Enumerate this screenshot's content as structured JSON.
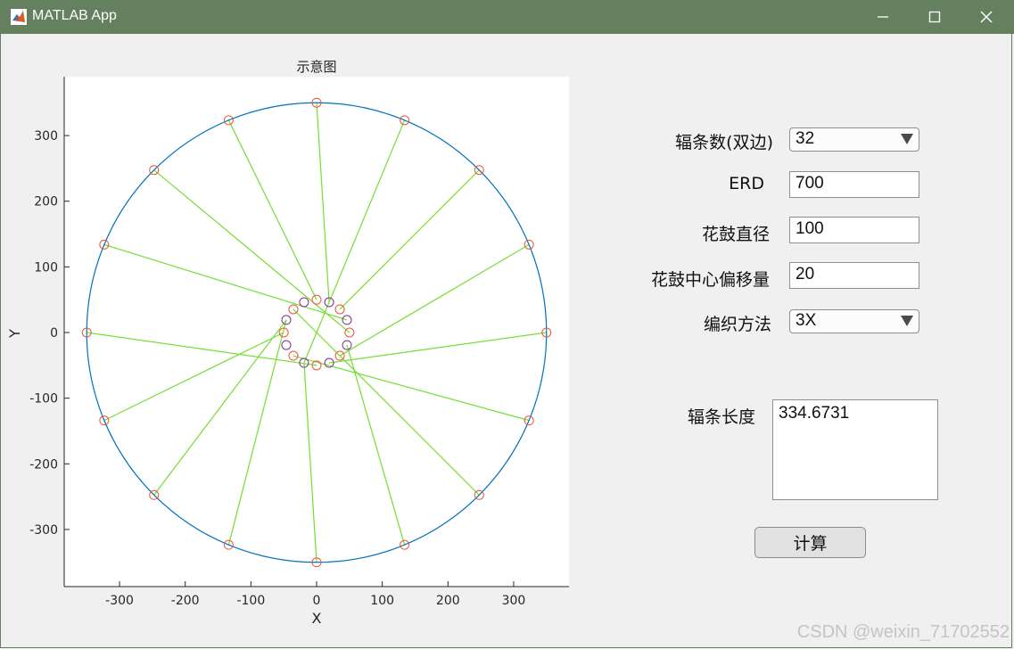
{
  "window": {
    "title": "MATLAB App",
    "minimize_icon": "minimize-icon",
    "maximize_icon": "maximize-icon",
    "close_icon": "close-icon",
    "titlebar_color": "#64805f"
  },
  "form": {
    "spokes_label": "辐条数(双边)",
    "spokes_value": "32",
    "erd_label": "ERD",
    "erd_value": "700",
    "hub_diameter_label": "花鼓直径",
    "hub_diameter_value": "100",
    "hub_offset_label": "花鼓中心偏移量",
    "hub_offset_value": "20",
    "lacing_label": "编织方法",
    "lacing_value": "3X",
    "spoke_length_label": "辐条长度",
    "spoke_length_value": "334.6731",
    "calc_button": "计算"
  },
  "watermark": "CSDN @weixin_71702552",
  "chart_data": {
    "type": "line",
    "title": "示意图",
    "xlabel": "X",
    "ylabel": "Y",
    "xlim": [
      -385,
      385
    ],
    "ylim": [
      -385,
      385
    ],
    "xticks": [
      -300,
      -200,
      -100,
      0,
      100,
      200,
      300
    ],
    "yticks": [
      -300,
      -200,
      -100,
      0,
      100,
      200,
      300
    ],
    "rim_radius": 350,
    "hub_radius": 50,
    "rim_holes": 16,
    "hub_holes": 16,
    "colors": {
      "rim": "#0072bd",
      "spoke": "#77dd33",
      "rim_hole": "#e8553a",
      "hub_hole": "#7e2f8e"
    },
    "spokes": [
      {
        "hub": [
          0,
          50
        ],
        "rim": [
          -133.9,
          323.4
        ]
      },
      {
        "hub": [
          35.4,
          35.4
        ],
        "rim": [
          247.5,
          247.5
        ]
      },
      {
        "hub": [
          50,
          0
        ],
        "rim": [
          -247.5,
          247.5
        ]
      },
      {
        "hub": [
          35.4,
          -35.4
        ],
        "rim": [
          323.4,
          133.9
        ]
      },
      {
        "hub": [
          0,
          -50
        ],
        "rim": [
          -350,
          0
        ]
      },
      {
        "hub": [
          -35.4,
          -35.4
        ],
        "rim": [
          323.4,
          -133.9
        ]
      },
      {
        "hub": [
          -50,
          0
        ],
        "rim": [
          -323.4,
          -133.9
        ]
      },
      {
        "hub": [
          -35.4,
          35.4
        ],
        "rim": [
          247.5,
          -247.5
        ]
      },
      {
        "hub": [
          19.1,
          46.2
        ],
        "rim": [
          0,
          350
        ]
      },
      {
        "hub": [
          46.2,
          -19.1
        ],
        "rim": [
          133.9,
          -323.4
        ]
      },
      {
        "hub": [
          -19.1,
          -46.2
        ],
        "rim": [
          133.9,
          323.4
        ]
      },
      {
        "hub": [
          -46.2,
          19.1
        ],
        "rim": [
          -247.5,
          -247.5
        ]
      },
      {
        "hub": [
          46.2,
          19.1
        ],
        "rim": [
          -323.4,
          133.9
        ]
      },
      {
        "hub": [
          19.1,
          -46.2
        ],
        "rim": [
          350,
          0
        ]
      },
      {
        "hub": [
          -19.1,
          -46.2
        ],
        "rim": [
          0,
          -350
        ]
      },
      {
        "hub": [
          -46.2,
          19.1
        ],
        "rim": [
          -133.9,
          -323.4
        ]
      }
    ]
  }
}
